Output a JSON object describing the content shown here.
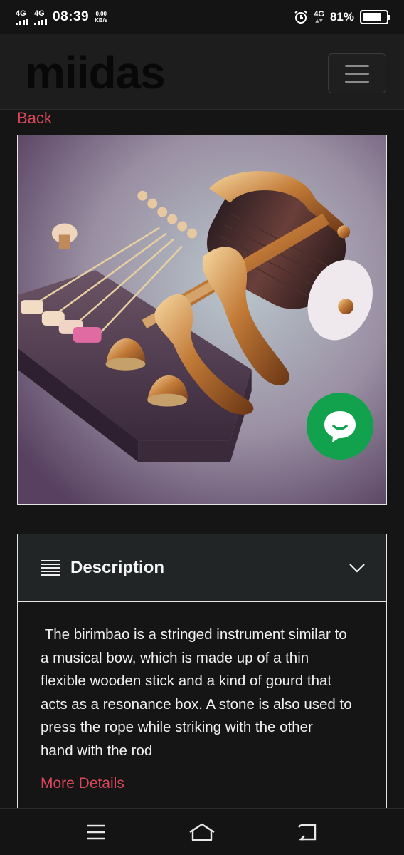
{
  "status_bar": {
    "network_1": "4G",
    "network_2": "4G",
    "time": "08:39",
    "speed_value": "0.00",
    "speed_unit": "KB/s",
    "network_right": "4G",
    "battery_percent": "81%",
    "battery_level": 0.81,
    "icons": [
      "alarm-icon",
      "battery-icon",
      "signal-icon"
    ]
  },
  "header": {
    "logo": "miidas",
    "menu_icon": "hamburger-icon"
  },
  "back_label": "Back",
  "product": {
    "image_alt": "Golden stringed musical instrument",
    "chat_icon": "chat-bubble-icon",
    "chat_color": "#12a24e"
  },
  "description": {
    "title": "Description",
    "title_icon": "text-lines-icon",
    "toggle_icon": "chevron-down-icon",
    "text": " The birimbao is a stringed instrument similar to\na musical bow, which is made up of a thin\nflexible wooden stick and a kind of gourd that\nacts as a resonance box. A stone is also used to\npress the rope while striking with the other\nhand with the rod",
    "more_label": "More Details"
  },
  "nav_bar": {
    "icons": [
      "menu-icon",
      "home-icon",
      "back-icon"
    ]
  },
  "colors": {
    "accent": "#d9485a",
    "background": "#151515",
    "header": "#1d1d1d"
  }
}
